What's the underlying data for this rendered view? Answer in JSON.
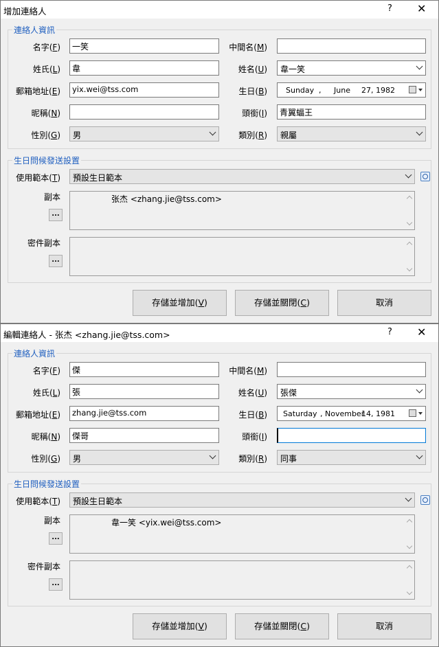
{
  "dialogs": [
    {
      "title": "增加連絡人",
      "help": "?",
      "close": "✕",
      "contact_group_title": "連絡人資訊",
      "labels": {
        "first_name": [
          "名字(",
          "F",
          ")"
        ],
        "middle_name": [
          "中間名(",
          "M",
          ")"
        ],
        "last_name": [
          "姓氏(",
          "L",
          ")"
        ],
        "full_name": [
          "姓名(",
          "U",
          ")"
        ],
        "email": [
          "郵箱地址(",
          "E",
          ")"
        ],
        "birthday": [
          "生日(",
          "B",
          ")"
        ],
        "nickname": [
          "昵稱(",
          "N",
          ")"
        ],
        "job_title": [
          "頭銜(",
          "I",
          ")"
        ],
        "gender": [
          "性別(",
          "G",
          ")"
        ],
        "category": [
          "類別(",
          "R",
          ")"
        ]
      },
      "values": {
        "first_name": "一笑",
        "middle_name": "",
        "last_name": "韋",
        "full_name": "韋一笑",
        "email": "yix.wei@tss.com",
        "birthday": {
          "weekday": "Sunday",
          "sep": ",",
          "month": "June",
          "day_year": "27, 1982"
        },
        "nickname": "",
        "job_title": "青翼蝠王",
        "gender": "男",
        "category": "親屬"
      },
      "birthday_group_title": "生日問候發送設置",
      "template_label": [
        "使用範本(",
        "T",
        ")"
      ],
      "template_value": "預設生日範本",
      "cc_label": "副本",
      "cc_value": "张杰 <zhang.jie@tss.com>",
      "bcc_label": "密件副本",
      "bcc_value": "",
      "dots": "...",
      "buttons": {
        "save_add": [
          "存儲並增加(",
          "V",
          ")"
        ],
        "save_close": [
          "存儲並關閉(",
          "C",
          ")"
        ],
        "cancel": "取消"
      }
    },
    {
      "title": "編輯連絡人 - 张杰 <zhang.jie@tss.com>",
      "help": "?",
      "close": "✕",
      "contact_group_title": "連絡人資訊",
      "labels": {
        "first_name": [
          "名字(",
          "F",
          ")"
        ],
        "middle_name": [
          "中間名(",
          "M",
          ")"
        ],
        "last_name": [
          "姓氏(",
          "L",
          ")"
        ],
        "full_name": [
          "姓名(",
          "U",
          ")"
        ],
        "email": [
          "郵箱地址(",
          "E",
          ")"
        ],
        "birthday": [
          "生日(",
          "B",
          ")"
        ],
        "nickname": [
          "昵稱(",
          "N",
          ")"
        ],
        "job_title": [
          "頭銜(",
          "I",
          ")"
        ],
        "gender": [
          "性別(",
          "G",
          ")"
        ],
        "category": [
          "類別(",
          "R",
          ")"
        ]
      },
      "values": {
        "first_name": "傑",
        "middle_name": "",
        "last_name": "張",
        "full_name": "張傑",
        "email": "zhang.jie@tss.com",
        "birthday": {
          "weekday": "Saturday",
          "sep": ",",
          "month": "November",
          "day_year": "14, 1981"
        },
        "nickname": "傑哥",
        "job_title": "",
        "gender": "男",
        "category": "同事"
      },
      "birthday_group_title": "生日問候發送設置",
      "template_label": [
        "使用範本(",
        "T",
        ")"
      ],
      "template_value": "預設生日範本",
      "cc_label": "副本",
      "cc_value": "韋一笑 <yix.wei@tss.com>",
      "bcc_label": "密件副本",
      "bcc_value": "",
      "dots": "...",
      "buttons": {
        "save_add": [
          "存儲並增加(",
          "V",
          ")"
        ],
        "save_close": [
          "存儲並關閉(",
          "C",
          ")"
        ],
        "cancel": "取消"
      }
    }
  ]
}
